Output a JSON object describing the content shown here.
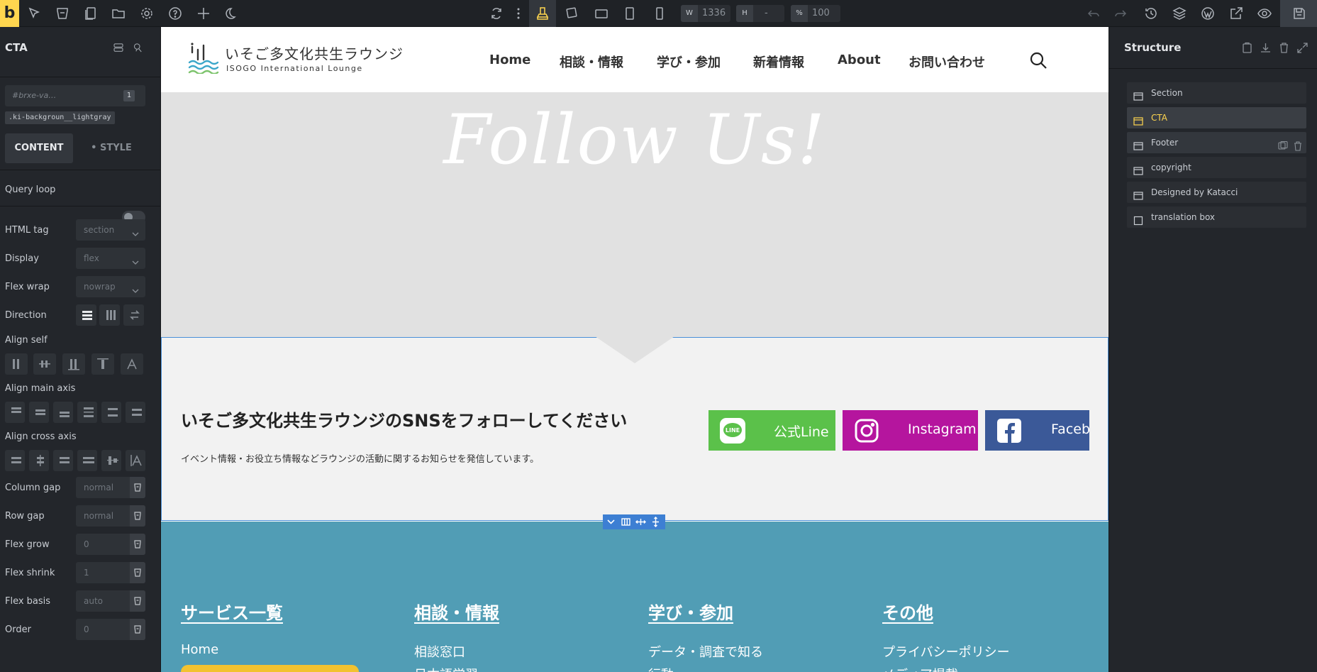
{
  "builder": {
    "logo": "b",
    "dimensions": {
      "w_label": "W",
      "w_value": "1336",
      "h_label": "H",
      "h_value": "-",
      "zoom_label": "%",
      "zoom_value": "100"
    }
  },
  "left_panel": {
    "title": "CTA",
    "id_placeholder": "#brxe-va…",
    "id_badge": "1",
    "class_tag": ".ki-backgroun__lightgray",
    "tabs": {
      "content": "CONTENT",
      "style": "• STYLE"
    },
    "query_loop_label": "Query loop",
    "controls": {
      "html_tag": {
        "label": "HTML tag",
        "value": "section"
      },
      "display": {
        "label": "Display",
        "value": "flex"
      },
      "flex_wrap": {
        "label": "Flex wrap",
        "value": "nowrap"
      },
      "direction": {
        "label": "Direction"
      },
      "align_self": {
        "label": "Align self"
      },
      "align_main_axis": {
        "label": "Align main axis"
      },
      "align_cross_axis": {
        "label": "Align cross axis"
      },
      "column_gap": {
        "label": "Column gap",
        "placeholder": "normal"
      },
      "row_gap": {
        "label": "Row gap",
        "placeholder": "normal"
      },
      "flex_grow": {
        "label": "Flex grow",
        "placeholder": "0"
      },
      "flex_shrink": {
        "label": "Flex shrink",
        "placeholder": "1"
      },
      "flex_basis": {
        "label": "Flex basis",
        "placeholder": "auto"
      },
      "order": {
        "label": "Order",
        "placeholder": "0"
      }
    }
  },
  "site": {
    "logo_jp": "いそご多文化共生ラウンジ",
    "logo_en": "ISOGO International Lounge",
    "nav": [
      "Home",
      "相談・情報",
      "学び・参加",
      "新着情報",
      "About",
      "お問い合わせ"
    ],
    "hero_title": "Follow Us!",
    "cta": {
      "heading": "いそご多文化共生ラウンジのSNSをフォローしてください",
      "text": "イベント情報・お役立ち情報などラウンジの活動に関するお知らせを発信しています。",
      "buttons": [
        {
          "label": "公式Line",
          "icon": "line-icon",
          "color": "#5bc14a"
        },
        {
          "label": "Instagram",
          "icon": "instagram-icon",
          "color": "#b5159e"
        },
        {
          "label": "Facebo",
          "icon": "facebook-icon",
          "color": "#3b5998"
        }
      ]
    },
    "footer": {
      "columns": [
        {
          "heading": "サービス一覧",
          "links": [
            "Home"
          ]
        },
        {
          "heading": "相談・情報",
          "links": [
            "相談窓口",
            "日本語学習"
          ]
        },
        {
          "heading": "学び・参加",
          "links": [
            "データ・調査で知る",
            "行動"
          ]
        },
        {
          "heading": "その他",
          "links": [
            "プライバシーポリシー",
            "メディア掲載"
          ]
        }
      ]
    }
  },
  "structure": {
    "title": "Structure",
    "items": [
      {
        "label": "Section",
        "state": "normal"
      },
      {
        "label": "CTA",
        "state": "active"
      },
      {
        "label": "Footer",
        "state": "hover"
      },
      {
        "label": "copyright",
        "state": "normal"
      },
      {
        "label": "Designed by Katacci",
        "state": "normal"
      },
      {
        "label": "translation box",
        "state": "normal"
      }
    ]
  },
  "colors": {
    "accent": "#ffd64f",
    "selection": "#4a90d9",
    "footer_bg": "#519db5",
    "hero_bg": "#e1e1e1"
  }
}
